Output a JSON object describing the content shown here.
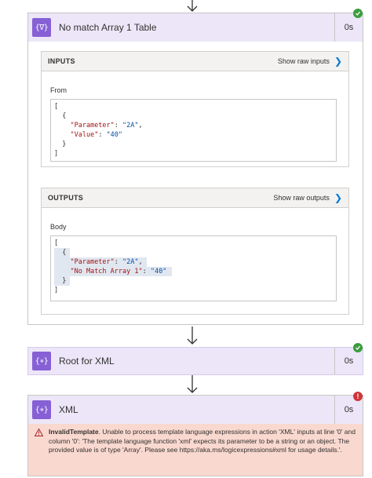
{
  "colors": {
    "accent": "#8660d4",
    "header_bg": "#ece6f8",
    "success": "#3c9d3c",
    "error": "#d13438",
    "error_bg": "#f9d8cf",
    "link": "#0078d4"
  },
  "actions": [
    {
      "title": "No match Array 1 Table",
      "duration": "0s",
      "icon": "curly-braces-icon",
      "status": "success",
      "inputs": {
        "header": "INPUTS",
        "raw_link": "Show raw inputs",
        "field_label": "From",
        "code": [
          "[",
          "  {",
          "    \"Parameter\": \"2A\",",
          "    \"Value\": \"40\"",
          "  }",
          "]"
        ]
      },
      "outputs": {
        "header": "OUTPUTS",
        "raw_link": "Show raw outputs",
        "field_label": "Body",
        "code": [
          "[",
          "  {",
          "    \"Parameter\": \"2A\",",
          "    \"No Match Array 1\": \"40\"",
          "  }",
          "]"
        ]
      }
    },
    {
      "title": "Root for XML",
      "duration": "0s",
      "icon": "curly-braces-icon",
      "status": "success"
    },
    {
      "title": "XML",
      "duration": "0s",
      "icon": "curly-braces-icon",
      "status": "error",
      "error_title": "InvalidTemplate",
      "error_message": ". Unable to process template language expressions in action 'XML' inputs at line '0' and column '0': 'The template language function 'xml' expects its parameter to be a string or an object. The provided value is of type 'Array'. Please see https://aka.ms/logicexpressions#xml for usage details.'."
    }
  ]
}
